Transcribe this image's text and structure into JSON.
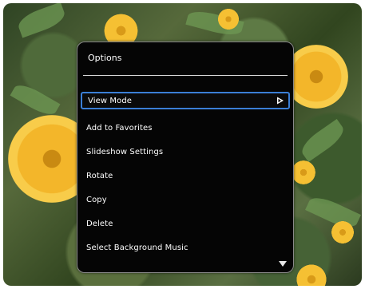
{
  "menu": {
    "title": "Options",
    "items": [
      {
        "label": "View Mode",
        "selected": true
      },
      {
        "label": "Add to Favorites",
        "selected": false
      },
      {
        "label": "Slideshow Settings",
        "selected": false
      },
      {
        "label": "Rotate",
        "selected": false
      },
      {
        "label": "Copy",
        "selected": false
      },
      {
        "label": "Delete",
        "selected": false
      },
      {
        "label": "Select Background Music",
        "selected": false
      }
    ],
    "submenu_indicator_icon": "triangle-right-icon",
    "scroll_indicator_icon": "triangle-down-icon"
  },
  "colors": {
    "panel_bg": "#050505",
    "highlight": "#3b7fd6",
    "text": "#ffffff"
  }
}
